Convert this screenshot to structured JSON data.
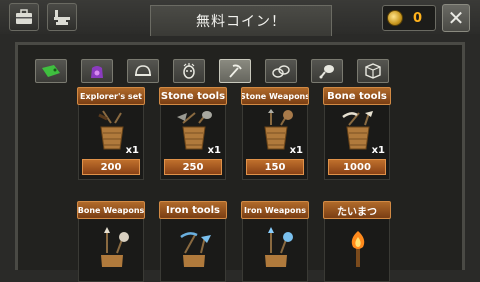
{
  "title": "無料コイン！",
  "coins": "0",
  "close_label": "✕",
  "tabs": [
    {
      "icon": "ticket-icon",
      "glyph": "🎫",
      "active": false
    },
    {
      "icon": "gift-bag-icon",
      "glyph": "🎁",
      "active": false
    },
    {
      "icon": "helmet-icon",
      "glyph": "⛑",
      "active": false
    },
    {
      "icon": "tribal-mask-icon",
      "glyph": "☸",
      "active": false
    },
    {
      "icon": "pickaxe-icon",
      "glyph": "⛏",
      "active": true
    },
    {
      "icon": "rocks-icon",
      "glyph": "◈",
      "active": false
    },
    {
      "icon": "meat-icon",
      "glyph": "🍖",
      "active": false
    },
    {
      "icon": "crate-icon",
      "glyph": "▣",
      "active": false
    }
  ],
  "items": [
    {
      "name": "Explorer's set",
      "qty": "x1",
      "price": "200"
    },
    {
      "name": "Stone tools",
      "qty": "x1",
      "price": "250"
    },
    {
      "name": "Stone Weapons",
      "qty": "x1",
      "price": "150"
    },
    {
      "name": "Bone tools",
      "qty": "x1",
      "price": "1000"
    },
    {
      "name": "Bone Weapons"
    },
    {
      "name": "Iron tools"
    },
    {
      "name": "Iron Weapons"
    },
    {
      "name": "たいまつ"
    }
  ]
}
